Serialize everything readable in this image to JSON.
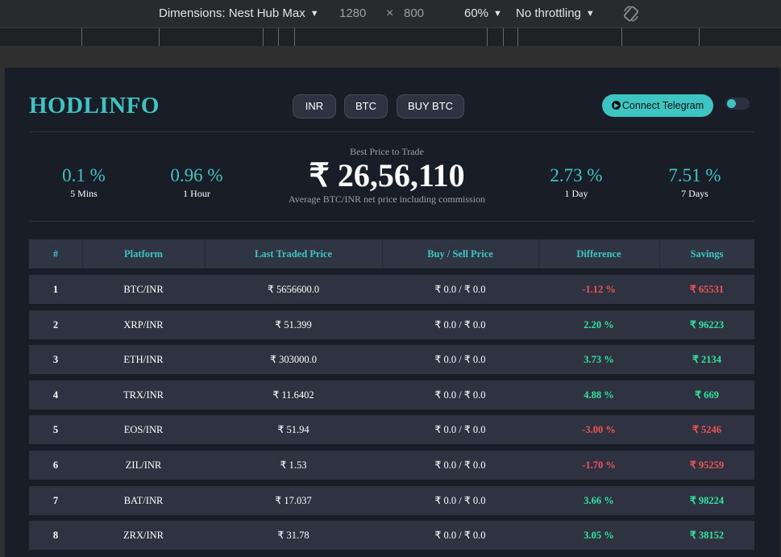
{
  "devtools": {
    "device_label": "Dimensions: Nest Hub Max",
    "width": "1280",
    "times": "×",
    "height": "800",
    "zoom": "60%",
    "throttling": "No throttling",
    "rotate_icon": "rotate-icon"
  },
  "header": {
    "logo": "HODLINFO",
    "buttons": [
      "INR",
      "BTC",
      "BUY BTC"
    ],
    "telegram": "Connect Telegram",
    "theme_toggle": "on"
  },
  "stats": {
    "left": [
      {
        "value": "0.1 %",
        "label": "5 Mins"
      },
      {
        "value": "0.96 %",
        "label": "1 Hour"
      }
    ],
    "best": {
      "caption": "Best Price to Trade",
      "price": "₹ 26,56,110",
      "subtitle": "Average BTC/INR net price including commission"
    },
    "right": [
      {
        "value": "2.73 %",
        "label": "1 Day"
      },
      {
        "value": "7.51 %",
        "label": "7 Days"
      }
    ]
  },
  "colors": {
    "accent": "#3dc6c1",
    "positive": "#2ee6a0",
    "negative": "#f05454",
    "page_bg": "#191d28",
    "row_bg": "#2f3241"
  },
  "table": {
    "headers": [
      "#",
      "Platform",
      "Last Traded Price",
      "Buy / Sell Price",
      "Difference",
      "Savings"
    ],
    "rows": [
      {
        "rank": "1",
        "platform": "BTC/INR",
        "last": "₹ 5656600.0",
        "buysell": "₹ 0.0 / ₹ 0.0",
        "diff": "-1.12 %",
        "savings": "₹ 65531",
        "positive": false
      },
      {
        "rank": "2",
        "platform": "XRP/INR",
        "last": "₹ 51.399",
        "buysell": "₹ 0.0 / ₹ 0.0",
        "diff": "2.20 %",
        "savings": "₹ 96223",
        "positive": true
      },
      {
        "rank": "3",
        "platform": "ETH/INR",
        "last": "₹ 303000.0",
        "buysell": "₹ 0.0 / ₹ 0.0",
        "diff": "3.73 %",
        "savings": "₹ 2134",
        "positive": true
      },
      {
        "rank": "4",
        "platform": "TRX/INR",
        "last": "₹ 11.6402",
        "buysell": "₹ 0.0 / ₹ 0.0",
        "diff": "4.88 %",
        "savings": "₹ 669",
        "positive": true
      },
      {
        "rank": "5",
        "platform": "EOS/INR",
        "last": "₹ 51.94",
        "buysell": "₹ 0.0 / ₹ 0.0",
        "diff": "-3.00 %",
        "savings": "₹ 5246",
        "positive": false
      },
      {
        "rank": "6",
        "platform": "ZIL/INR",
        "last": "₹ 1.53",
        "buysell": "₹ 0.0 / ₹ 0.0",
        "diff": "-1.70 %",
        "savings": "₹ 95259",
        "positive": false
      },
      {
        "rank": "7",
        "platform": "BAT/INR",
        "last": "₹ 17.037",
        "buysell": "₹ 0.0 / ₹ 0.0",
        "diff": "3.66 %",
        "savings": "₹ 98224",
        "positive": true
      },
      {
        "rank": "8",
        "platform": "ZRX/INR",
        "last": "₹ 31.78",
        "buysell": "₹ 0.0 / ₹ 0.0",
        "diff": "3.05 %",
        "savings": "₹ 38152",
        "positive": true
      }
    ]
  }
}
